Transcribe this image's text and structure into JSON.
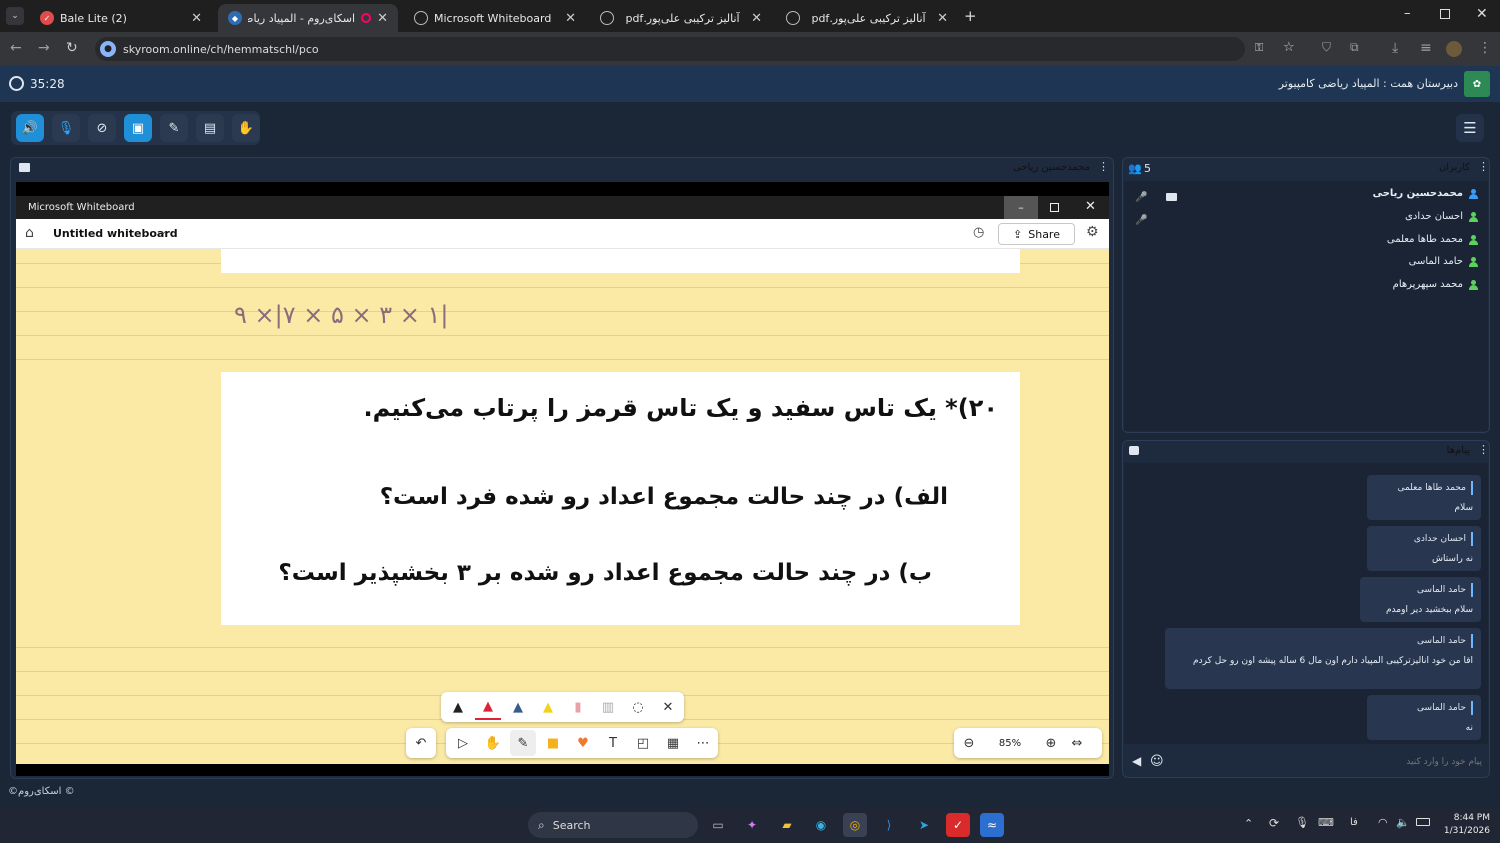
{
  "browser": {
    "tabs": [
      {
        "title": "Bale Lite (2)"
      },
      {
        "title": "اسکای‌روم - المپیاد ریاضی کا"
      },
      {
        "title": "Microsoft Whiteboard"
      },
      {
        "title": "آنالیز ترکیبی علی‌پور.pdf"
      },
      {
        "title": "آنالیز ترکیبی علی‌پور.pdf"
      }
    ],
    "url": "skyroom.online/ch/hemmatschl/pco"
  },
  "skyroom": {
    "timer": "35:28",
    "room_title": "دبیرستان همت : المپیاد ریاضی کامپیوتر",
    "presenter_name": "محمدحسین ریاحی",
    "users_title": "کاربران",
    "users_count": "5",
    "users": [
      {
        "name": "محمدحسین ریاحی",
        "color": "#3b9cff"
      },
      {
        "name": "احسان حدادی",
        "color": "#5bd25b"
      },
      {
        "name": "محمد طاها معلمی",
        "color": "#5bd25b"
      },
      {
        "name": "حامد الماسی",
        "color": "#5bd25b"
      },
      {
        "name": "محمد سپهرپرهام",
        "color": "#5bd25b"
      }
    ],
    "messages_title": "پیام‌ها",
    "messages": [
      {
        "author": "محمد طاها معلمی",
        "text": "سلام"
      },
      {
        "author": "احسان حدادی",
        "text": "نه راستاش"
      },
      {
        "author": "حامد الماسی",
        "text": "سلام ببخشید دیر اومدم"
      },
      {
        "author": "حامد الماسی",
        "text": "اقا من خود انالیزترکیبی المپیاد دارم اون مال 6 ساله پیشه اون رو حل کردم"
      },
      {
        "author": "حامد الماسی",
        "text": "نه"
      }
    ],
    "chat_placeholder": "پیام خود را وارد کنید",
    "copyright": "©اسکای‌روم ©"
  },
  "whiteboard": {
    "window_title": "Microsoft Whiteboard",
    "doc_title": "Untitled whiteboard",
    "share_label": "Share",
    "handwriting": "۹ ×|۷ × ۵ × ۳ × ۱|",
    "problem_title": "۲۰)* یک تاس سفید و یک تاس قرمز را پرتاب می‌کنیم.",
    "part_a": "الف)  در چند حالت مجموع اعداد رو شده فرد است؟",
    "part_b": "ب)  در چند حالت مجموع اعداد رو شده بر ۳ بخشپذیر است؟",
    "zoom": "85%"
  },
  "taskbar": {
    "search_label": "Search",
    "time": "8:44 PM",
    "date": "1/31/2026"
  }
}
